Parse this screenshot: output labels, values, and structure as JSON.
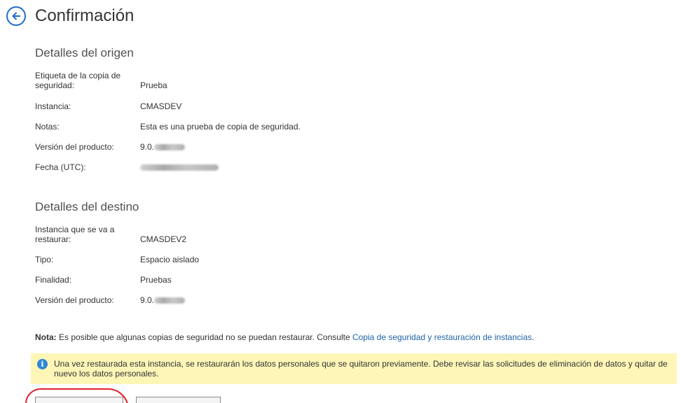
{
  "header": {
    "title": "Confirmación",
    "back_icon": "back-arrow-icon"
  },
  "source": {
    "title": "Detalles del origen",
    "rows": [
      {
        "label": "Etiqueta de la copia de seguridad:",
        "value": "Prueba"
      },
      {
        "label": "Instancia:",
        "value": "CMASDEV"
      },
      {
        "label": "Notas:",
        "value": "Esta es una prueba de copia de seguridad."
      },
      {
        "label": "Versión del producto:",
        "value": "9.0."
      },
      {
        "label": "Fecha (UTC):",
        "value": ""
      }
    ]
  },
  "target": {
    "title": "Detalles del destino",
    "rows": [
      {
        "label": "Instancia que se va a restaurar:",
        "value": "CMASDEV2"
      },
      {
        "label": "Tipo:",
        "value": "Espacio aislado"
      },
      {
        "label": "Finalidad:",
        "value": "Pruebas"
      },
      {
        "label": "Versión del producto:",
        "value": "9.0."
      }
    ]
  },
  "note": {
    "bold": "Nota:",
    "text": " Es posible que algunas copias de seguridad no se puedan restaurar. Consulte ",
    "link": "Copia de seguridad y restauración de instancias",
    "end": "."
  },
  "info": {
    "icon": "info-icon",
    "text": "Una vez restaurada esta instancia, se restaurarán los datos personales que se quitaron previamente. Debe revisar las solicitudes de eliminación de datos y quitar de nuevo los datos personales."
  },
  "colors": {
    "accent": "#1f6fc5",
    "info_bg": "#fdf6b7",
    "highlight": "#e0202a"
  }
}
